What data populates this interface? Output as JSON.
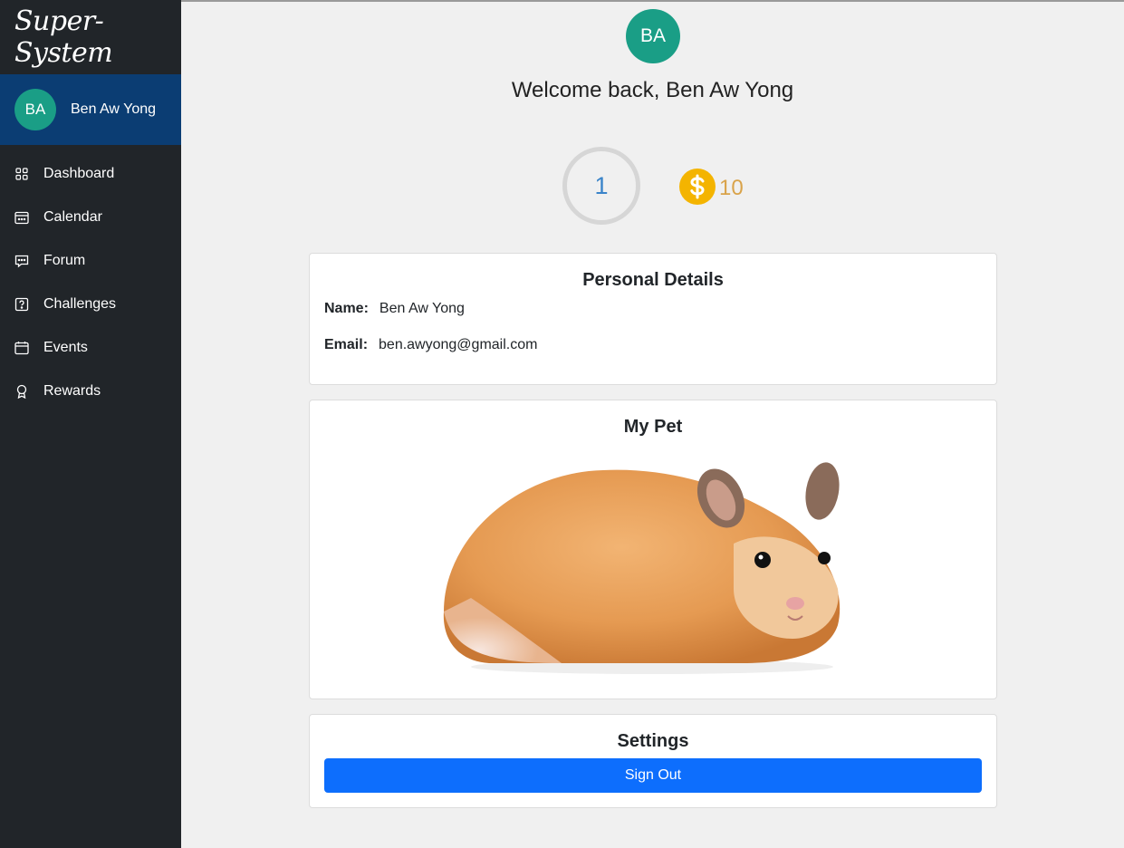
{
  "app": {
    "brand": "Super-System"
  },
  "user": {
    "initials": "BA",
    "name": "Ben Aw Yong"
  },
  "sidebar": {
    "items": [
      {
        "label": "Dashboard",
        "icon": "grid-icon"
      },
      {
        "label": "Calendar",
        "icon": "calendar-icon"
      },
      {
        "label": "Forum",
        "icon": "chat-icon"
      },
      {
        "label": "Challenges",
        "icon": "question-icon"
      },
      {
        "label": "Events",
        "icon": "event-icon"
      },
      {
        "label": "Rewards",
        "icon": "award-icon"
      }
    ]
  },
  "header": {
    "welcome": "Welcome back, Ben Aw Yong"
  },
  "stats": {
    "level": "1",
    "coins": "10"
  },
  "personal": {
    "title": "Personal Details",
    "name_label": "Name:",
    "name_value": "Ben Aw Yong",
    "email_label": "Email:",
    "email_value": "ben.awyong@gmail.com"
  },
  "pet": {
    "title": "My Pet",
    "image": "hamster"
  },
  "settings": {
    "title": "Settings",
    "signout_label": "Sign Out"
  },
  "colors": {
    "sidebar_bg": "#212529",
    "user_block_bg": "#0b3d73",
    "avatar_bg": "#1a9e86",
    "primary": "#0d6efd",
    "coin": "#f4b400"
  }
}
